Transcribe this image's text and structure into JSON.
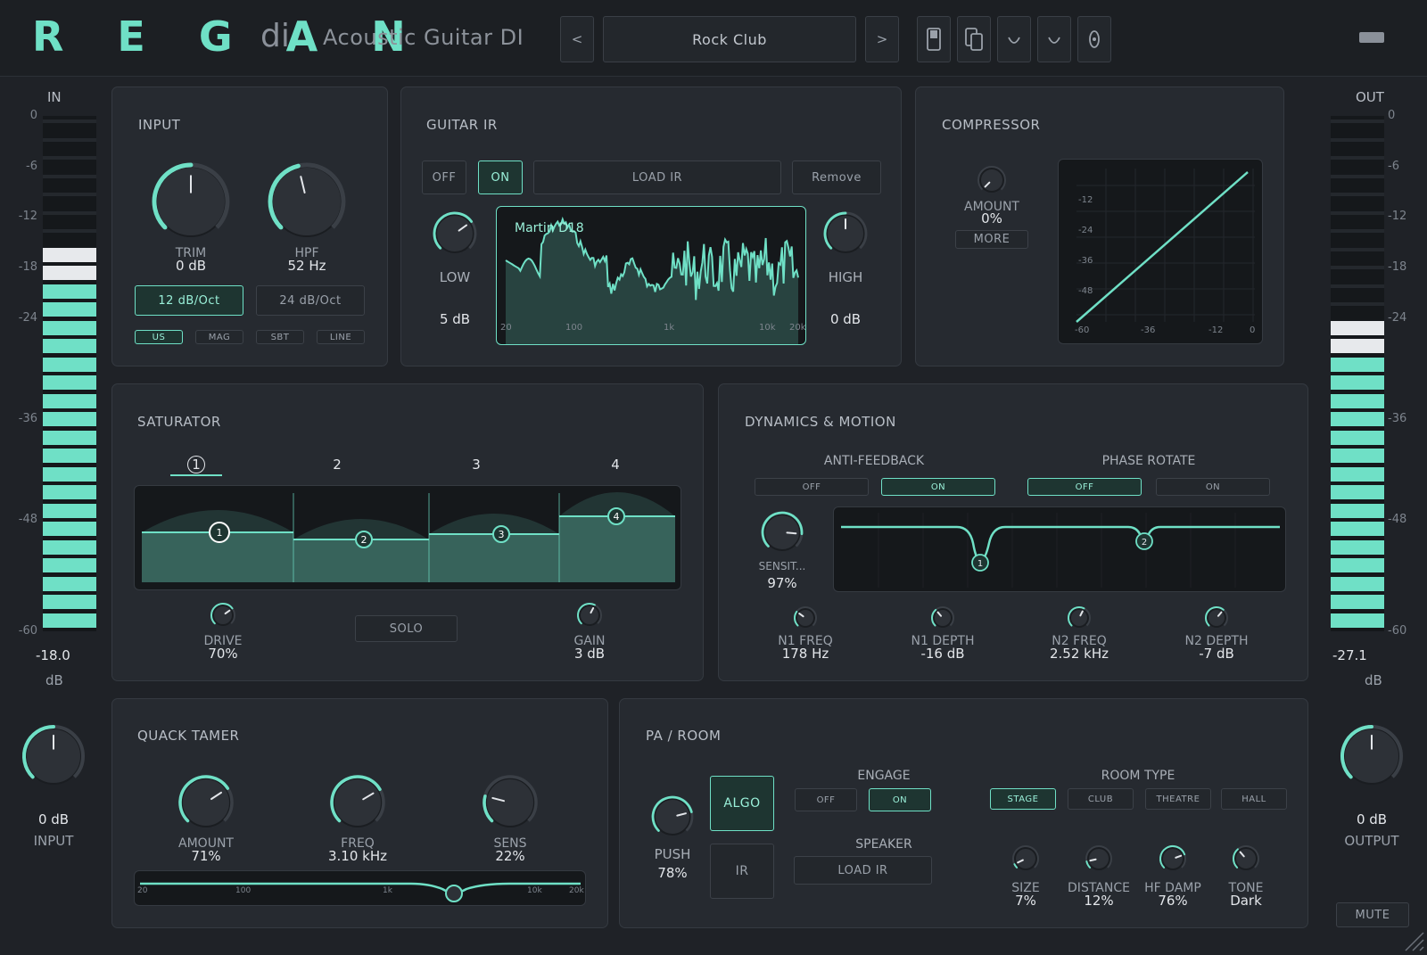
{
  "header": {
    "logo": "R E G A N",
    "logo_suffix": "di",
    "plugin_name": "Acoustic Guitar DI",
    "preset": "Rock Club",
    "prev": "<",
    "next": ">"
  },
  "meters": {
    "in_label": "IN",
    "out_label": "OUT",
    "ticks": [
      "0",
      "-6",
      "-12",
      "-18",
      "-24",
      "-36",
      "-48",
      "-60"
    ],
    "in_value": "-18.0",
    "out_value": "-27.1",
    "unit": "dB",
    "in_level_db": -18.0,
    "out_level_db": -27.1
  },
  "input_knob": {
    "value": "0 dB",
    "label": "INPUT"
  },
  "output_knob": {
    "value": "0 dB",
    "label": "OUTPUT"
  },
  "mute": "MUTE",
  "input": {
    "title": "INPUT",
    "trim_label": "TRIM",
    "trim_value": "0 dB",
    "hpf_label": "HPF",
    "hpf_value": "52 Hz",
    "slope_a": "12 dB/Oct",
    "slope_b": "24 dB/Oct",
    "pickups": [
      "US",
      "MAG",
      "SBT",
      "LINE"
    ]
  },
  "guitar_ir": {
    "title": "GUITAR IR",
    "off": "OFF",
    "on": "ON",
    "load": "LOAD IR",
    "remove": "Remove",
    "low_label": "LOW",
    "low_value": "5 dB",
    "high_label": "HIGH",
    "high_value": "0 dB",
    "ir_name": "Martin D18",
    "freq_ticks": [
      "20",
      "100",
      "1k",
      "10k",
      "20k"
    ]
  },
  "compressor": {
    "title": "COMPRESSOR",
    "amount_label": "AMOUNT",
    "amount_value": "0%",
    "more": "MORE",
    "y_ticks": [
      "-12",
      "-24",
      "-36",
      "-48"
    ],
    "x_ticks": [
      "-60",
      "-36",
      "-12",
      "0"
    ]
  },
  "saturator": {
    "title": "SATURATOR",
    "bands": [
      "1",
      "2",
      "3",
      "4"
    ],
    "drive_label": "DRIVE",
    "drive_value": "70%",
    "solo": "SOLO",
    "gain_label": "GAIN",
    "gain_value": "3 dB"
  },
  "dynamics": {
    "title": "DYNAMICS & MOTION",
    "anti_feedback": "ANTI-FEEDBACK",
    "phase_rotate": "PHASE ROTATE",
    "off": "OFF",
    "on": "ON",
    "sens_label": "SENSIT...",
    "sens_value": "97%",
    "n1_freq_label": "N1 FREQ",
    "n1_freq_value": "178 Hz",
    "n1_depth_label": "N1 DEPTH",
    "n1_depth_value": "-16 dB",
    "n2_freq_label": "N2 FREQ",
    "n2_freq_value": "2.52 kHz",
    "n2_depth_label": "N2 DEPTH",
    "n2_depth_value": "-7 dB",
    "notch_1": "1",
    "notch_2": "2"
  },
  "quack": {
    "title": "QUACK TAMER",
    "amount_label": "AMOUNT",
    "amount_value": "71%",
    "freq_label": "FREQ",
    "freq_value": "3.10 kHz",
    "sens_label": "SENS",
    "sens_value": "22%",
    "freq_ticks": [
      "20",
      "100",
      "1k",
      "10k",
      "20k"
    ]
  },
  "pa_room": {
    "title": "PA / ROOM",
    "push_label": "PUSH",
    "push_value": "78%",
    "algo": "ALGO",
    "ir": "IR",
    "engage": "ENGAGE",
    "off": "OFF",
    "on": "ON",
    "speaker": "SPEAKER",
    "load_ir": "LOAD IR",
    "room_type": "ROOM TYPE",
    "rooms": [
      "STAGE",
      "CLUB",
      "THEATRE",
      "HALL"
    ],
    "size_label": "SIZE",
    "size_value": "7%",
    "distance_label": "DISTANCE",
    "distance_value": "12%",
    "hfdamp_label": "HF DAMP",
    "hfdamp_value": "76%",
    "tone_label": "TONE",
    "tone_value": "Dark"
  },
  "colors": {
    "accent": "#6fe0c6",
    "background": "#1f2227",
    "panel": "#262a30"
  }
}
